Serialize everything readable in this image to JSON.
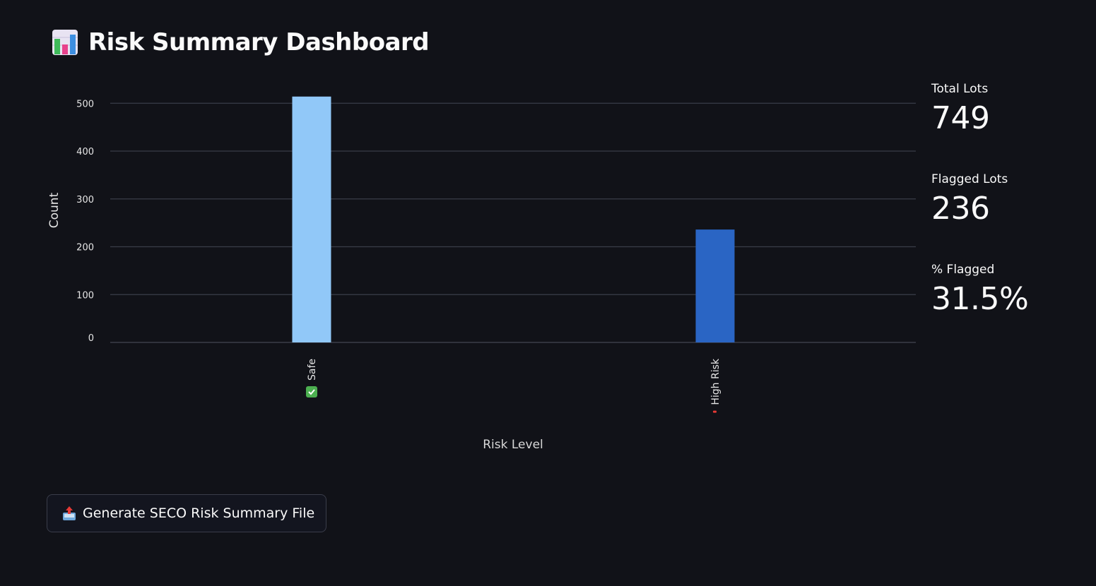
{
  "header": {
    "title": "Risk Summary Dashboard",
    "icon": "bar-chart-icon"
  },
  "chart_data": {
    "type": "bar",
    "categories": [
      "Safe",
      "High Risk"
    ],
    "category_icons": [
      "check-mark-icon",
      "exclamation-icon"
    ],
    "values": [
      514,
      236
    ],
    "bar_colors": [
      "#91c8f8",
      "#2a65c4"
    ],
    "title": "",
    "xlabel": "Risk Level",
    "ylabel": "Count",
    "ylim": [
      0,
      500
    ],
    "yticks": [
      0,
      100,
      200,
      300,
      400,
      500
    ],
    "grid": true,
    "legend": "none"
  },
  "metrics": [
    {
      "label": "Total Lots",
      "value": "749"
    },
    {
      "label": "Flagged Lots",
      "value": "236"
    },
    {
      "label": "% Flagged",
      "value": "31.5%"
    }
  ],
  "actions": {
    "generate_button_label": "Generate SECO Risk Summary File",
    "generate_button_icon": "outbox-tray-icon"
  },
  "colors": {
    "background": "#111218",
    "text": "#fafafa",
    "grid": "#3a3d48",
    "safe_icon": "#4caf50",
    "high_risk_icon": "#e53935"
  }
}
